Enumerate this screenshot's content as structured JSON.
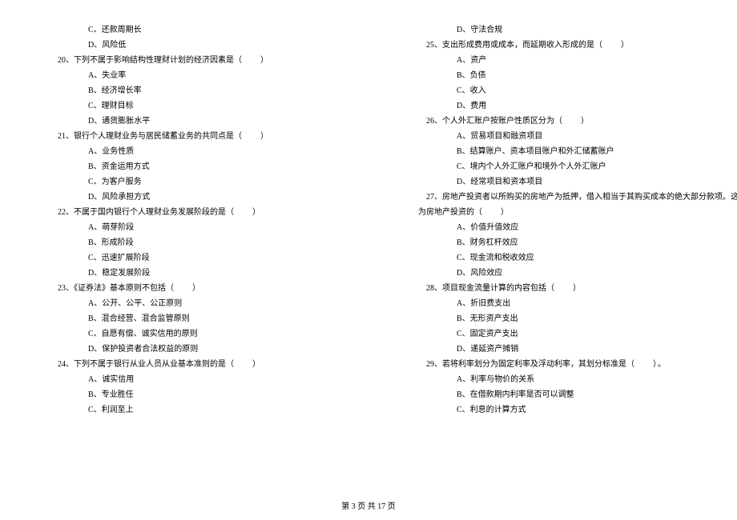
{
  "footer": "第 3 页 共 17 页",
  "blank": "（　　）",
  "blank_end": "（　　）。",
  "left": {
    "pre_opts": [
      "C、还款周期长",
      "D、风险低"
    ],
    "questions": [
      {
        "num": "20、",
        "text": "下列不属于影响结构性理财计划的经济因素是",
        "blank_key": "blank",
        "opts": [
          "A、失业率",
          "B、经济增长率",
          "C、理财目标",
          "D、通货膨胀水平"
        ]
      },
      {
        "num": "21、",
        "text": "银行个人理财业务与居民储蓄业务的共同点是",
        "blank_key": "blank",
        "opts": [
          "A、业务性质",
          "B、资金运用方式",
          "C、为客户服务",
          "D、风险承担方式"
        ]
      },
      {
        "num": "22、",
        "text": "不属于国内银行个人理财业务发展阶段的是",
        "blank_key": "blank",
        "opts": [
          "A、萌芽阶段",
          "B、形成阶段",
          "C、迅速扩展阶段",
          "D、稳定发展阶段"
        ]
      },
      {
        "num": "23、",
        "text": "《证券法》基本原则不包括",
        "blank_key": "blank",
        "opts": [
          "A、公开、公平、公正原则",
          "B、混合经营、混合监管原则",
          "C、自愿有偿、诚实信用的原则",
          "D、保护投资者合法权益的原则"
        ]
      },
      {
        "num": "24、",
        "text": "下列不属于银行从业人员从业基本准则的是",
        "blank_key": "blank",
        "opts": [
          "A、诚实信用",
          "B、专业胜任",
          "C、利润至上"
        ]
      }
    ]
  },
  "right": {
    "pre_opts": [
      "D、守法合规"
    ],
    "questions": [
      {
        "num": "25、",
        "text": "支出形成费用或成本，而延期收入形成的是",
        "blank_key": "blank",
        "opts": [
          "A、资产",
          "B、负债",
          "C、收入",
          "D、费用"
        ]
      },
      {
        "num": "26、",
        "text": "个人外汇账户按账户性质区分为",
        "blank_key": "blank",
        "opts": [
          "A、贸易项目和融资项目",
          "B、结算账户、资本项目账户和外汇储蓄账户",
          "C、境内个人外汇账户和境外个人外汇账户",
          "D、经常项目和资本项目"
        ]
      },
      {
        "num": "27、",
        "text": "房地产投资者以所购买的房地产为抵押，借入相当于其购买成本的绝大部分款项。这被称",
        "cont": "为房地产投资的",
        "blank_key": "blank",
        "opts": [
          "A、价值升值效应",
          "B、财务杠杆效应",
          "C、现金流和税收效应",
          "D、风险效应"
        ]
      },
      {
        "num": "28、",
        "text": "项目现金流量计算的内容包括",
        "blank_key": "blank",
        "opts": [
          "A、折旧费支出",
          "B、无形资产支出",
          "C、固定资产支出",
          "D、递延资产摊销"
        ]
      },
      {
        "num": "29、",
        "text": "若将利率划分为固定利率及浮动利率，其划分标准是",
        "blank_key": "blank_end",
        "opts": [
          "A、利率与物价的关系",
          "B、在借款期内利率是否可以调整",
          "C、利息的计算方式"
        ]
      }
    ]
  }
}
